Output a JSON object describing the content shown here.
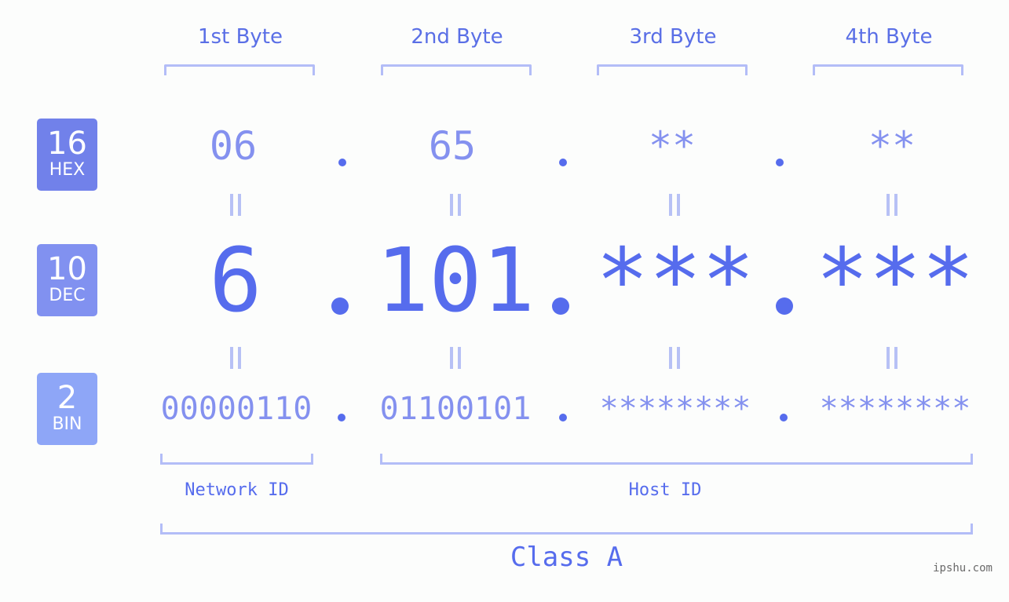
{
  "byte_headers": [
    "1st Byte",
    "2nd Byte",
    "3rd Byte",
    "4th Byte"
  ],
  "bases": {
    "hex": {
      "number": "16",
      "label": "HEX",
      "color": "#7181ea"
    },
    "dec": {
      "number": "10",
      "label": "DEC",
      "color": "#8191f0"
    },
    "bin": {
      "number": "2",
      "label": "BIN",
      "color": "#8ea6f7"
    }
  },
  "hex_values": [
    "06",
    "65",
    "**",
    "**"
  ],
  "dec_values": [
    "6",
    "101",
    "***",
    "***"
  ],
  "bin_values": [
    "00000110",
    "01100101",
    "********",
    "********"
  ],
  "separator": ".",
  "equals_symbol": "||",
  "network_id_label": "Network ID",
  "host_id_label": "Host ID",
  "class_label": "Class A",
  "watermark": "ipshu.com",
  "colors": {
    "accent": "#566ced",
    "value_light": "#8491ef",
    "bracket": "#b3bdf7",
    "background": "#fcfdfc"
  }
}
